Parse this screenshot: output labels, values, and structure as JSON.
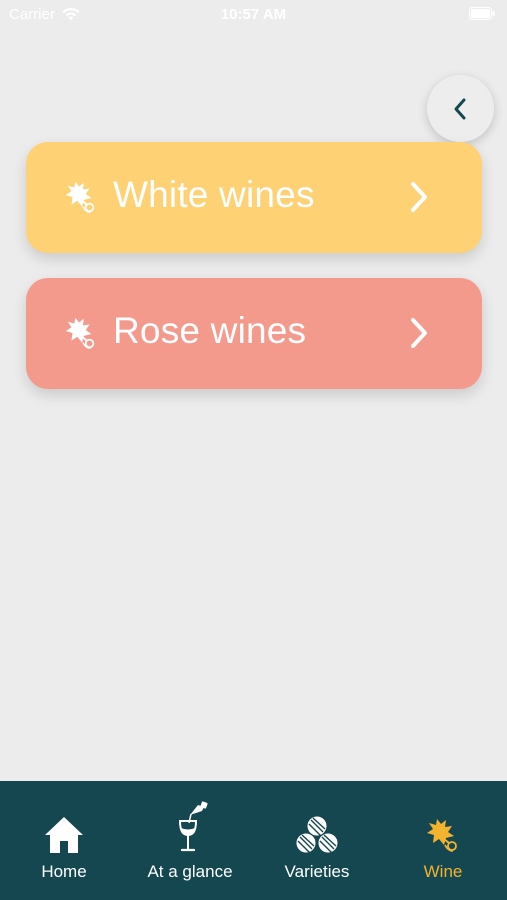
{
  "status_bar": {
    "carrier": "Carrier",
    "time": "10:57 AM"
  },
  "nav": {
    "back_icon": "chevron-left-icon"
  },
  "categories": [
    {
      "label": "White wines",
      "icon": "grape-leaf-icon",
      "color": "#ffd175"
    },
    {
      "label": "Rose wines",
      "icon": "grape-leaf-icon",
      "color": "#f49a8d"
    }
  ],
  "tabbar": {
    "background": "#154751",
    "active_color": "#f3b32f",
    "tabs": [
      {
        "label": "Home",
        "icon": "house-icon",
        "active": false
      },
      {
        "label": "At a glance",
        "icon": "wine-pour-icon",
        "active": false
      },
      {
        "label": "Varieties",
        "icon": "barrels-icon",
        "active": false
      },
      {
        "label": "Wine",
        "icon": "grape-leaf-icon",
        "active": true
      }
    ]
  }
}
